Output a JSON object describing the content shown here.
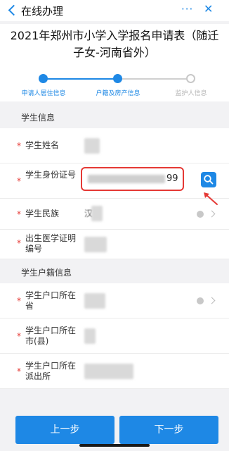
{
  "nav": {
    "title": "在线办理",
    "more": "···",
    "close": "✕"
  },
  "form_title": "2021年郑州市小学入学报名申请表（随迁子女-河南省外）",
  "steps": [
    {
      "label": "申请人居住信息",
      "state": "done",
      "color": "#1e88e5"
    },
    {
      "label": "户籍及房产信息",
      "state": "current",
      "color": "#1e88e5"
    },
    {
      "label": "监护人信息",
      "state": "todo",
      "color": "#b5b5b5"
    }
  ],
  "sections": {
    "student_info": "学生信息",
    "student_household": "学生户籍信息"
  },
  "fields": {
    "name": {
      "required": "*",
      "label": "学生姓名"
    },
    "id_number": {
      "required": "*",
      "label": "学生身份证号",
      "visible_suffix": "99"
    },
    "ethnicity": {
      "required": "*",
      "label": "学生民族",
      "visible_prefix": "汉"
    },
    "birth_cert": {
      "required": "*",
      "label": "出生医学证明编号"
    },
    "hukou_province": {
      "required": "*",
      "label": "学生户口所在省"
    },
    "hukou_city": {
      "required": "*",
      "label": "学生户口所在市(县)"
    },
    "hukou_station": {
      "required": "*",
      "label": "学生户口所在派出所"
    }
  },
  "buttons": {
    "prev": "上一步",
    "next": "下一步"
  },
  "colors": {
    "accent": "#1e88e5",
    "required": "#e53935",
    "highlight": "#e53935"
  },
  "icons": {
    "back": "chevron-left-icon",
    "search": "search-icon",
    "clear": "clear-icon",
    "chevron": "chevron-right-icon",
    "annotation": "red-arrow-icon"
  }
}
